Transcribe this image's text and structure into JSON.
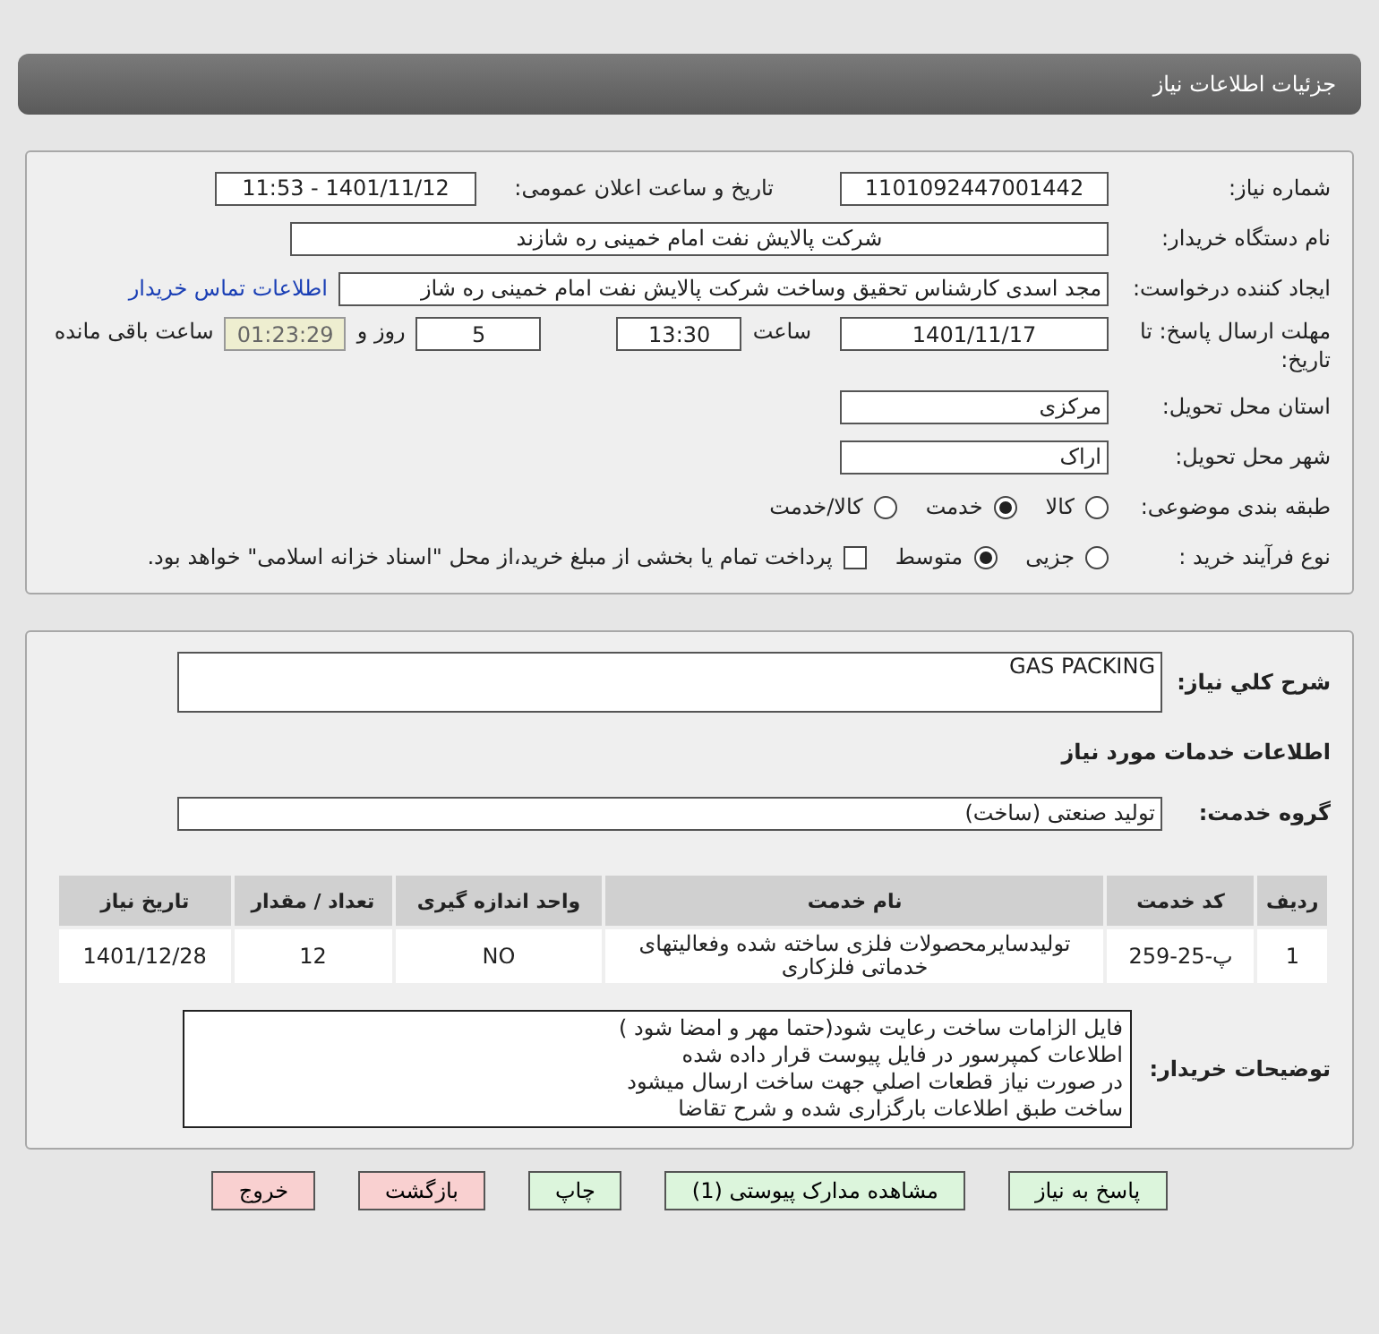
{
  "header": {
    "title": "جزئیات اطلاعات نیاز"
  },
  "details": {
    "need_number": {
      "label": "شماره نیاز:",
      "value": "1101092447001442"
    },
    "announce": {
      "label": "تاریخ و ساعت اعلان عمومی:",
      "value": "1401/11/12 - 11:53"
    },
    "buyer_org": {
      "label": "نام دستگاه خریدار:",
      "value": "شرکت پالایش نفت امام خمینی  ره  شازند"
    },
    "requester": {
      "label": "ایجاد کننده درخواست:",
      "value": "مجد اسدی کارشناس تحقیق وساخت شرکت پالایش نفت امام خمینی  ره  شاز",
      "link": "اطلاعات تماس خریدار"
    },
    "deadline": {
      "label": "مهلت ارسال پاسخ: تا تاریخ:",
      "date": "1401/11/17",
      "time_label": "ساعت",
      "time": "13:30",
      "days": "5",
      "days_label": "روز و",
      "remaining": "01:23:29",
      "remaining_label": "ساعت باقی مانده"
    },
    "province": {
      "label": "استان محل تحویل:",
      "value": "مرکزی"
    },
    "city": {
      "label": "شهر محل تحویل:",
      "value": "اراک"
    },
    "category": {
      "label": "طبقه بندی موضوعی:",
      "options": [
        {
          "label": "کالا",
          "selected": false
        },
        {
          "label": "خدمت",
          "selected": true
        },
        {
          "label": "کالا/خدمت",
          "selected": false
        }
      ]
    },
    "process": {
      "label": "نوع فرآیند خرید :",
      "options": [
        {
          "label": "جزیی",
          "selected": false
        },
        {
          "label": "متوسط",
          "selected": true
        }
      ],
      "treasury": {
        "label": "پرداخت تمام یا بخشی از مبلغ خرید،از محل \"اسناد خزانه اسلامی\" خواهد بود.",
        "checked": false
      }
    }
  },
  "services": {
    "description": {
      "label": "شرح کلي نياز:",
      "value": "GAS PACKING"
    },
    "section_title": "اطلاعات خدمات مورد نیاز",
    "group": {
      "label": "گروه خدمت:",
      "value": "تولید صنعتی (ساخت)"
    },
    "table": {
      "columns": [
        "ردیف",
        "کد خدمت",
        "نام خدمت",
        "واحد اندازه گیری",
        "تعداد / مقدار",
        "تاریخ نیاز"
      ],
      "rows": [
        [
          "1",
          "پ-25-259",
          "تولیدسایرمحصولات فلزی ساخته شده وفعالیتهای خدماتی فلزکاری",
          "NO",
          "12",
          "1401/12/28"
        ]
      ]
    },
    "notes": {
      "label": "توضیحات خریدار:",
      "lines": [
        "فایل الزامات ساخت رعایت شود(حتما مهر و امضا شود )",
        "اطلاعات کمپرسور در فایل پیوست قرار داده شده",
        "در صورت نیاز قطعات اصلي جهت ساخت ارسال میشود",
        "ساخت طبق اطلاعات بارگزاری شده و شرح تقاضا"
      ]
    }
  },
  "buttons": [
    {
      "label": "پاسخ به نیاز",
      "kind": "primary"
    },
    {
      "label": "مشاهده مدارک پیوستی (1)",
      "kind": "primary"
    },
    {
      "label": "چاپ",
      "kind": "primary"
    },
    {
      "label": "بازگشت",
      "kind": "danger"
    },
    {
      "label": "خروج",
      "kind": "danger"
    }
  ]
}
